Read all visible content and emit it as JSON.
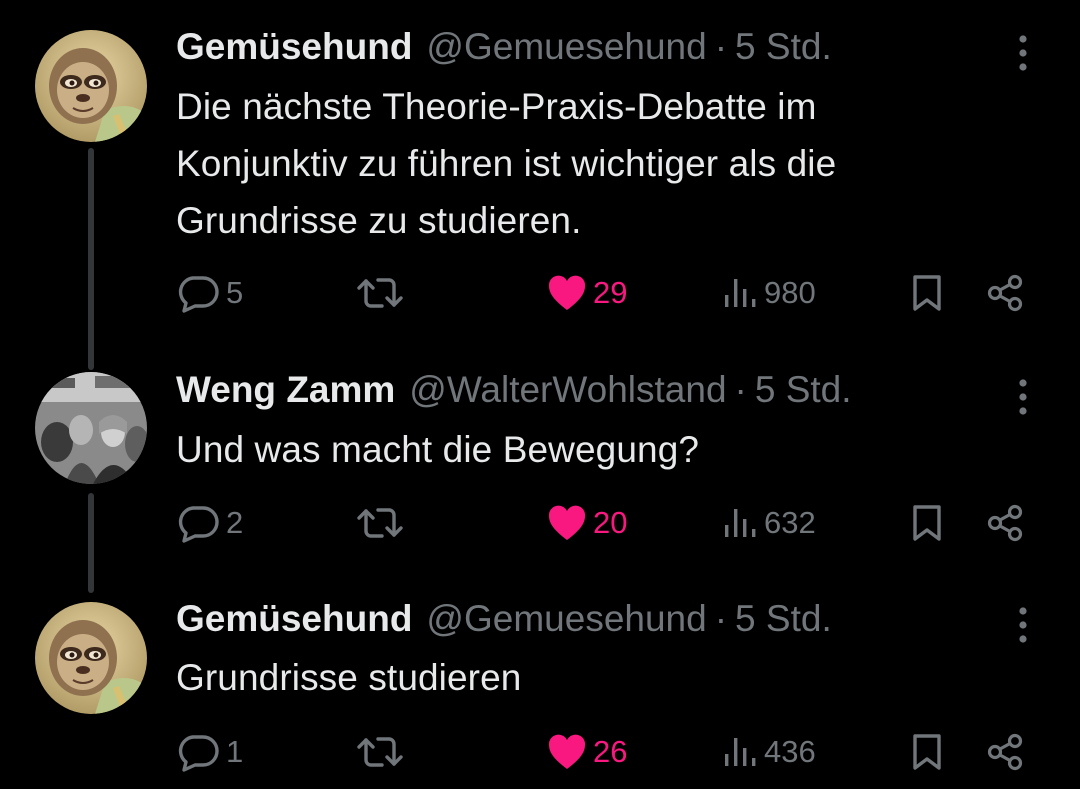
{
  "thread": [
    {
      "display_name": "Gemüsehund",
      "handle": "@Gemuesehund",
      "separator": "·",
      "time": "5 Std.",
      "lines": [
        "Die nächste Theorie-Praxis-Debatte im",
        "Konjunktiv zu führen ist wichtiger als die",
        "Grundrisse zu studieren."
      ],
      "avatar_icon": "sloth-avatar",
      "replies": "5",
      "likes": "29",
      "views": "980"
    },
    {
      "display_name": "Weng Zamm",
      "handle": "@WalterWohlstand",
      "separator": "·",
      "time": "5 Std.",
      "lines": [
        "Und was macht die Bewegung?"
      ],
      "avatar_icon": "bw-photo-avatar",
      "replies": "2",
      "likes": "20",
      "views": "632"
    },
    {
      "display_name": "Gemüsehund",
      "handle": "@Gemuesehund",
      "separator": "·",
      "time": "5 Std.",
      "lines": [
        "Grundrisse studieren"
      ],
      "avatar_icon": "sloth-avatar",
      "replies": "1",
      "likes": "26",
      "views": "436"
    }
  ],
  "colors": {
    "background": "#000000",
    "text_primary": "#e7e9ea",
    "text_secondary": "#71767b",
    "like_active": "#f91880",
    "thread_line": "#333639"
  },
  "icons": [
    "reply-icon",
    "retweet-icon",
    "heart-icon",
    "views-icon",
    "bookmark-icon",
    "share-icon",
    "more-icon"
  ]
}
